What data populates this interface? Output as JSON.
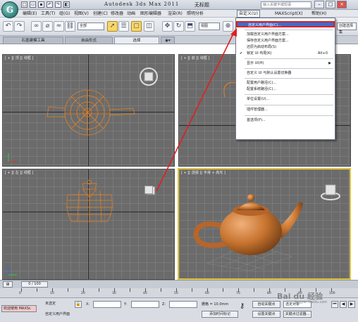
{
  "app": {
    "title": "Autodesk 3ds Max  2011",
    "document": "无标题",
    "logo": "G",
    "search_placeholder": "输入关键字或短语"
  },
  "menubar": [
    {
      "label": "编辑(E)"
    },
    {
      "label": "工具(T)"
    },
    {
      "label": "组(G)"
    },
    {
      "label": "视图(V)"
    },
    {
      "label": "创建(C)"
    },
    {
      "label": "修改器"
    },
    {
      "label": "动画"
    },
    {
      "label": "图形编辑器"
    },
    {
      "label": "渲染(R)"
    },
    {
      "label": "照明分析"
    },
    {
      "label": "自定义(U)"
    },
    {
      "label": "MAXScript(X)"
    },
    {
      "label": "帮助(H)"
    }
  ],
  "toolbar": {
    "selection_filter": "全部",
    "ref_coord": "视图",
    "create_selection": "创建选择集"
  },
  "ribbon_tabs": [
    {
      "label": "石墨建模工具"
    },
    {
      "label": "自由形式"
    },
    {
      "label": "选择"
    }
  ],
  "viewports": [
    {
      "label": "[ + ][ 顶 ][ 线框 ]"
    },
    {
      "label": "[ + ][ 前 ][ 线框 ]"
    },
    {
      "label": "[ + ][ 左 ][ 线框 ]"
    },
    {
      "label": "[ + ][ 透视 ][ 平滑 + 高光 ]"
    }
  ],
  "context_menu": {
    "items": [
      {
        "label": "自定义用户界面(C)...",
        "shortcut": "",
        "highlighted": true
      },
      {
        "label": "加载自定义用户界面方案...",
        "shortcut": ""
      },
      {
        "label": "保存自定义用户界面方案...",
        "shortcut": ""
      },
      {
        "label": "还原为启动布局(S)",
        "shortcut": ""
      },
      {
        "label": "锁定 UI 布局(K)",
        "shortcut": "Alt+0",
        "checked": true
      },
      {
        "label": "显示 UI(H)",
        "shortcut": "",
        "submenu": true
      },
      {
        "label": "自定义 UI 与默认设置切换器",
        "shortcut": ""
      },
      {
        "label": "配置用户路径(C)...",
        "shortcut": ""
      },
      {
        "label": "配置系统路径(C)...",
        "shortcut": ""
      },
      {
        "label": "单位设置(U)...",
        "shortcut": ""
      },
      {
        "label": "插件管理器...",
        "shortcut": ""
      },
      {
        "label": "首选项(P)...",
        "shortcut": ""
      }
    ]
  },
  "timeline": {
    "frame_display": "0 / 100",
    "ticks": [
      "0",
      "5",
      "10",
      "15",
      "20",
      "25",
      "30",
      "35",
      "40",
      "45",
      "50",
      "55",
      "60",
      "65",
      "70",
      "75",
      "80",
      "85",
      "90",
      "95",
      "100"
    ]
  },
  "statusbar": {
    "script_label": "欢迎使用 MAXSc",
    "selection_text": "未选定",
    "prompt_text": "自定义用户界面",
    "x_label": "X:",
    "y_label": "Y:",
    "z_label": "Z:",
    "grid_text": "栅格 = 10.0mm",
    "add_time_tag": "添加时间标记",
    "auto_key": "自动关键点",
    "set_key": "设置关键点",
    "selected_object": "选定对象",
    "key_filters": "关键点过滤器..."
  },
  "watermark": {
    "text": "Bai du 经验",
    "sub": "jingyan.baidu.com"
  },
  "colors": {
    "teapot_wire": "#e8821e",
    "teapot_solid": "#c7732e",
    "active_viewport": "#e1c43a",
    "menu_highlight": "#3d6bd0",
    "callout_red": "#e02020"
  }
}
